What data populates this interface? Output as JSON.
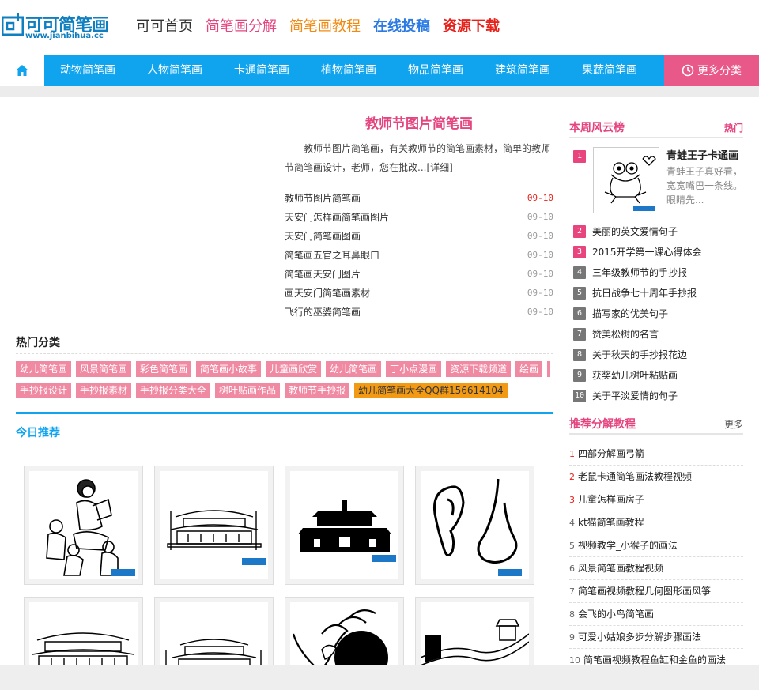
{
  "logo": {
    "text": "可可简笔画",
    "url": "www.jianbihua.cc"
  },
  "topnav": [
    "可可首页",
    "简笔画分解",
    "简笔画教程",
    "在线投稿",
    "资源下载"
  ],
  "catbar": {
    "items": [
      "动物简笔画",
      "人物简笔画",
      "卡通简笔画",
      "植物简笔画",
      "物品简笔画",
      "建筑简笔画",
      "果蔬简笔画"
    ],
    "more": "更多分类"
  },
  "feature": {
    "title": "教师节图片简笔画",
    "desc": "教师节图片简笔画，有关教师节的简笔画素材，简单的教师节简笔画设计，老师，您在批改...",
    "detail": "[详细]",
    "items": [
      {
        "title": "教师节图片简笔画",
        "date": "09-10"
      },
      {
        "title": "天安门怎样画简笔画图片",
        "date": "09-10"
      },
      {
        "title": "天安门简笔画图画",
        "date": "09-10"
      },
      {
        "title": "简笔画五官之耳鼻眼口",
        "date": "09-10"
      },
      {
        "title": "简笔画天安门图片",
        "date": "09-10"
      },
      {
        "title": "画天安门简笔画素材",
        "date": "09-10"
      },
      {
        "title": "飞行的巫婆简笔画",
        "date": "09-10"
      }
    ]
  },
  "hot": {
    "title": "热门分类",
    "row1": [
      "幼儿简笔画",
      "风景简笔画",
      "彩色简笔画",
      "简笔画小故事",
      "儿童画欣赏",
      "幼儿简笔画",
      "丁小点漫画",
      "资源下载频道",
      "绘画",
      "黑"
    ],
    "row2": [
      "手抄报设计",
      "手抄报素材",
      "手抄报分类大全",
      "树叶贴画作品",
      "教师节手抄报"
    ],
    "qq": "幼儿简笔画大全QQ群156614104"
  },
  "today": {
    "title": "今日推荐"
  },
  "ranking": {
    "title": "本周风云榜",
    "more": "热门",
    "top": {
      "num": "1",
      "title": "青蛙王子卡通画",
      "desc": "青蛙王子真好看，宽宽嘴巴一条线。眼睛先..."
    },
    "items": [
      {
        "num": "2",
        "text": "美丽的英文爱情句子"
      },
      {
        "num": "3",
        "text": "2015开学第一课心得体会"
      },
      {
        "num": "4",
        "text": "三年级教师节的手抄报"
      },
      {
        "num": "5",
        "text": "抗日战争七十周年手抄报"
      },
      {
        "num": "6",
        "text": "描写家的优美句子"
      },
      {
        "num": "7",
        "text": "赞美松树的名言"
      },
      {
        "num": "8",
        "text": "关于秋天的手抄报花边"
      },
      {
        "num": "9",
        "text": "获奖幼儿树叶粘贴画"
      },
      {
        "num": "10",
        "text": "关于平淡爱情的句子"
      }
    ]
  },
  "tutorials": {
    "title": "推荐分解教程",
    "more": "更多",
    "items": [
      {
        "num": "1",
        "text": "四部分解画弓箭"
      },
      {
        "num": "2",
        "text": "老鼠卡通简笔画法教程视频"
      },
      {
        "num": "3",
        "text": "儿童怎样画房子"
      },
      {
        "num": "4",
        "text": "kt猫简笔画教程"
      },
      {
        "num": "5",
        "text": "视频教学_小猴子的画法"
      },
      {
        "num": "6",
        "text": "风景简笔画教程视频"
      },
      {
        "num": "7",
        "text": "简笔画视频教程几何图形画风筝"
      },
      {
        "num": "8",
        "text": "会飞的小鸟简笔画"
      },
      {
        "num": "9",
        "text": "可爱小姑娘多步分解步骤画法"
      },
      {
        "num": "10",
        "text": "简笔画视频教程鱼缸和金鱼的画法"
      }
    ]
  }
}
